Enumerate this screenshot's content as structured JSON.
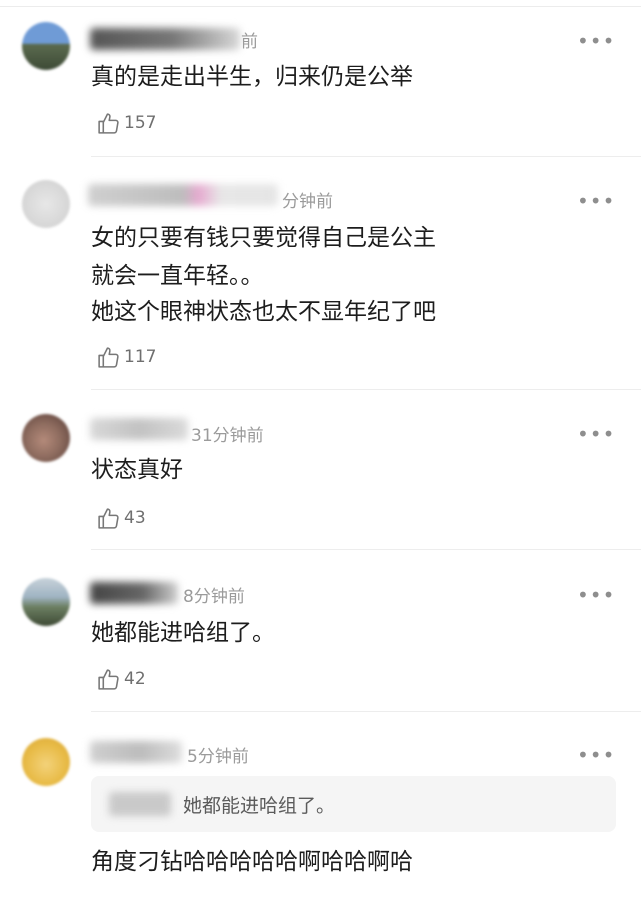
{
  "comments": [
    {
      "time": "前",
      "text_lines": [
        "真的是走出半生，归来仍是公举"
      ],
      "likes": "157"
    },
    {
      "time": "分钟前",
      "text_lines": [
        "女的只要有钱只要觉得自己是公主",
        "就会一直年轻。。",
        "她这个眼神状态也太不显年纪了吧"
      ],
      "likes": "117"
    },
    {
      "time": "31分钟前",
      "text_lines": [
        "状态真好"
      ],
      "likes": "43"
    },
    {
      "time": "8分钟前",
      "text_lines": [
        "她都能进哈组了。"
      ],
      "likes": "42"
    },
    {
      "time": "5分钟前",
      "quote": "她都能进哈组了。",
      "text_lines": [
        "角度刁钻哈哈哈哈哈啊哈哈啊哈"
      ]
    }
  ],
  "more_glyph": "•••",
  "icons": {
    "like": "thumbs-up-icon",
    "more": "more-dots-icon"
  },
  "colors": {
    "time": "#9b9b9b",
    "text": "#1d1d1d",
    "divider": "#ededed"
  }
}
